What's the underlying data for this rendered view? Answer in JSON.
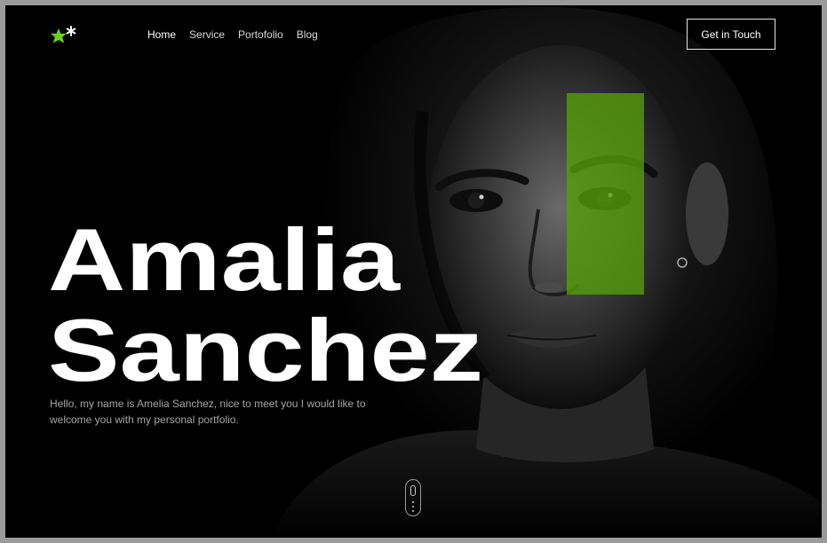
{
  "brand": {
    "logo_icon": "asterisk-logo-icon",
    "accent": "#6ad01a"
  },
  "nav": {
    "items": [
      {
        "label": "Home",
        "active": true
      },
      {
        "label": "Service",
        "active": false
      },
      {
        "label": "Portofolio",
        "active": false
      },
      {
        "label": "Blog",
        "active": false
      }
    ],
    "cta_label": "Get in Touch"
  },
  "hero": {
    "name_line1": "Amalia",
    "name_line2": "Sanchez",
    "intro": "Hello, my name is Amelia Sanchez, nice to meet you I would like to welcome you with my personal portfolio.",
    "highlight_color": "#56a00a"
  },
  "scroll_indicator": {
    "icon": "mouse-scroll-icon"
  }
}
